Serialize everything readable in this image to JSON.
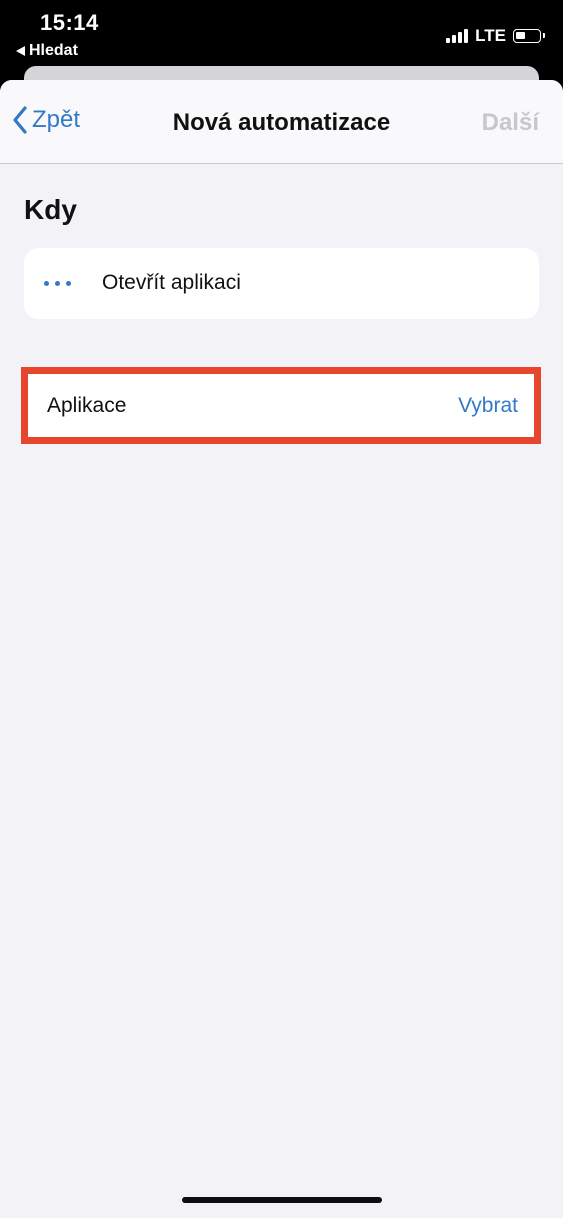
{
  "status_bar": {
    "time": "15:14",
    "back_app": "Hledat",
    "network": "LTE"
  },
  "nav": {
    "back_label": "Zpět",
    "title": "Nová automatizace",
    "next_label": "Další"
  },
  "section": {
    "title": "Kdy"
  },
  "trigger": {
    "label": "Otevřít aplikaci"
  },
  "app_row": {
    "label": "Aplikace",
    "action": "Vybrat"
  },
  "colors": {
    "accent": "#3478c8",
    "highlight": "#e8452e",
    "background": "#f2f2f7",
    "disabled": "#c7c7cc"
  },
  "icons": {
    "back": "chevron-left-icon",
    "trigger": "ellipsis-icon"
  }
}
